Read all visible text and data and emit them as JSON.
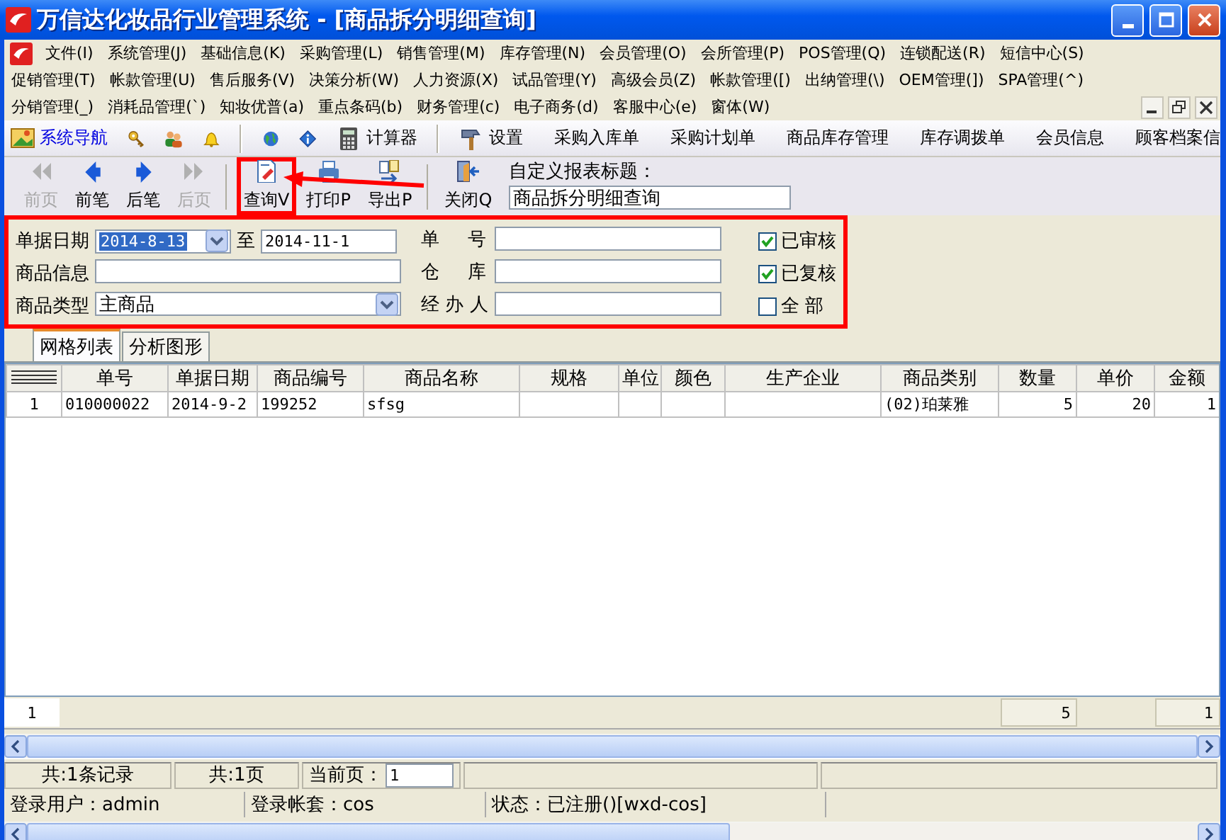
{
  "window": {
    "title": "万信达化妆品行业管理系统 - [商品拆分明细查询]"
  },
  "menu_rows": [
    {
      "items": [
        "文件(I)",
        "系统管理(J)",
        "基础信息(K)",
        "采购管理(L)",
        "销售管理(M)",
        "库存管理(N)",
        "会员管理(O)",
        "会所管理(P)",
        "POS管理(Q)",
        "连锁配送(R)",
        "短信中心(S)"
      ]
    },
    {
      "items": [
        "促销管理(T)",
        "帐款管理(U)",
        "售后服务(V)",
        "决策分析(W)",
        "人力资源(X)",
        "试品管理(Y)",
        "高级会员(Z)",
        "帐款管理([)",
        "出纳管理(\\)",
        "OEM管理(])",
        "SPA管理(^)"
      ]
    },
    {
      "items": [
        "分销管理(_)",
        "消耗品管理(`)",
        "知妆优普(a)",
        "重点条码(b)",
        "财务管理(c)",
        "电子商务(d)",
        "客服中心(e)",
        "窗体(W)"
      ]
    }
  ],
  "quick_bar": [
    {
      "kind": "link",
      "label": "系统导航"
    },
    {
      "kind": "icon"
    },
    {
      "kind": "icon"
    },
    {
      "kind": "icon"
    },
    {
      "kind": "separator"
    },
    {
      "kind": "icon"
    },
    {
      "kind": "icon"
    },
    {
      "kind": "icon-label",
      "label": "计算器"
    },
    {
      "kind": "separator"
    },
    {
      "kind": "icon-label",
      "label": "设置"
    },
    {
      "kind": "label",
      "label": "采购入库单"
    },
    {
      "kind": "label",
      "label": "采购计划单"
    },
    {
      "kind": "label",
      "label": "商品库存管理"
    },
    {
      "kind": "label",
      "label": "库存调拨单"
    },
    {
      "kind": "label",
      "label": "会员信息"
    },
    {
      "kind": "label",
      "label": "顾客档案信"
    }
  ],
  "toolbar": {
    "annotation_arrow": true,
    "buttons": [
      {
        "label": "前页",
        "disabled": true,
        "highlighted": false
      },
      {
        "label": "前笔",
        "disabled": false,
        "highlighted": false
      },
      {
        "label": "后笔",
        "disabled": false,
        "highlighted": false
      },
      {
        "label": "后页",
        "disabled": true,
        "highlighted": false
      },
      {
        "label": "查询V",
        "disabled": false,
        "highlighted": true
      },
      {
        "label": "打印P",
        "disabled": false,
        "highlighted": false
      },
      {
        "label": "导出P",
        "disabled": false,
        "highlighted": false
      },
      {
        "label": "关闭Q",
        "disabled": false,
        "highlighted": false
      }
    ]
  },
  "report_title": {
    "label": "自定义报表标题：",
    "value": "商品拆分明细查询"
  },
  "filters": {
    "highlighted": true,
    "date": {
      "label": "单据日期",
      "from": "2014-8-13",
      "separator": "至",
      "to": "2014-11-1"
    },
    "doc_no": {
      "label": "单 号"
    },
    "product_info": {
      "label": "商品信息"
    },
    "warehouse": {
      "label": "仓 库"
    },
    "product_type": {
      "label": "商品类型",
      "value": "主商品"
    },
    "handler": {
      "label": "经 办 人"
    },
    "checks": [
      {
        "label": "已审核",
        "checked": true
      },
      {
        "label": "已复核",
        "checked": true
      },
      {
        "label": "全 部",
        "checked": false
      }
    ]
  },
  "tabs": [
    {
      "label": "网格列表",
      "selected": true
    },
    {
      "label": "分析图形",
      "selected": false
    }
  ],
  "table": {
    "columns": [
      "单号",
      "单据日期",
      "商品编号",
      "商品名称",
      "规格",
      "单位",
      "颜色",
      "生产企业",
      "商品类别",
      "数量",
      "单价",
      "金额"
    ],
    "rows": [
      {
        "number": "1",
        "cells": [
          "010000022",
          "2014-9-2",
          "199252",
          "sfsg",
          null,
          null,
          null,
          null,
          "(02)珀莱雅",
          "5",
          "20",
          "1"
        ]
      }
    ],
    "footer": {
      "number": "1",
      "quantity": "5",
      "amount": "1"
    }
  },
  "pager": {
    "records": "共:1条记录",
    "pages": "共:1页",
    "current_label": "当前页：",
    "current_value": "1"
  },
  "status_bar": [
    "登录用户：admin",
    "登录帐套：cos",
    "状态：已注册()[wxd-cos]"
  ]
}
